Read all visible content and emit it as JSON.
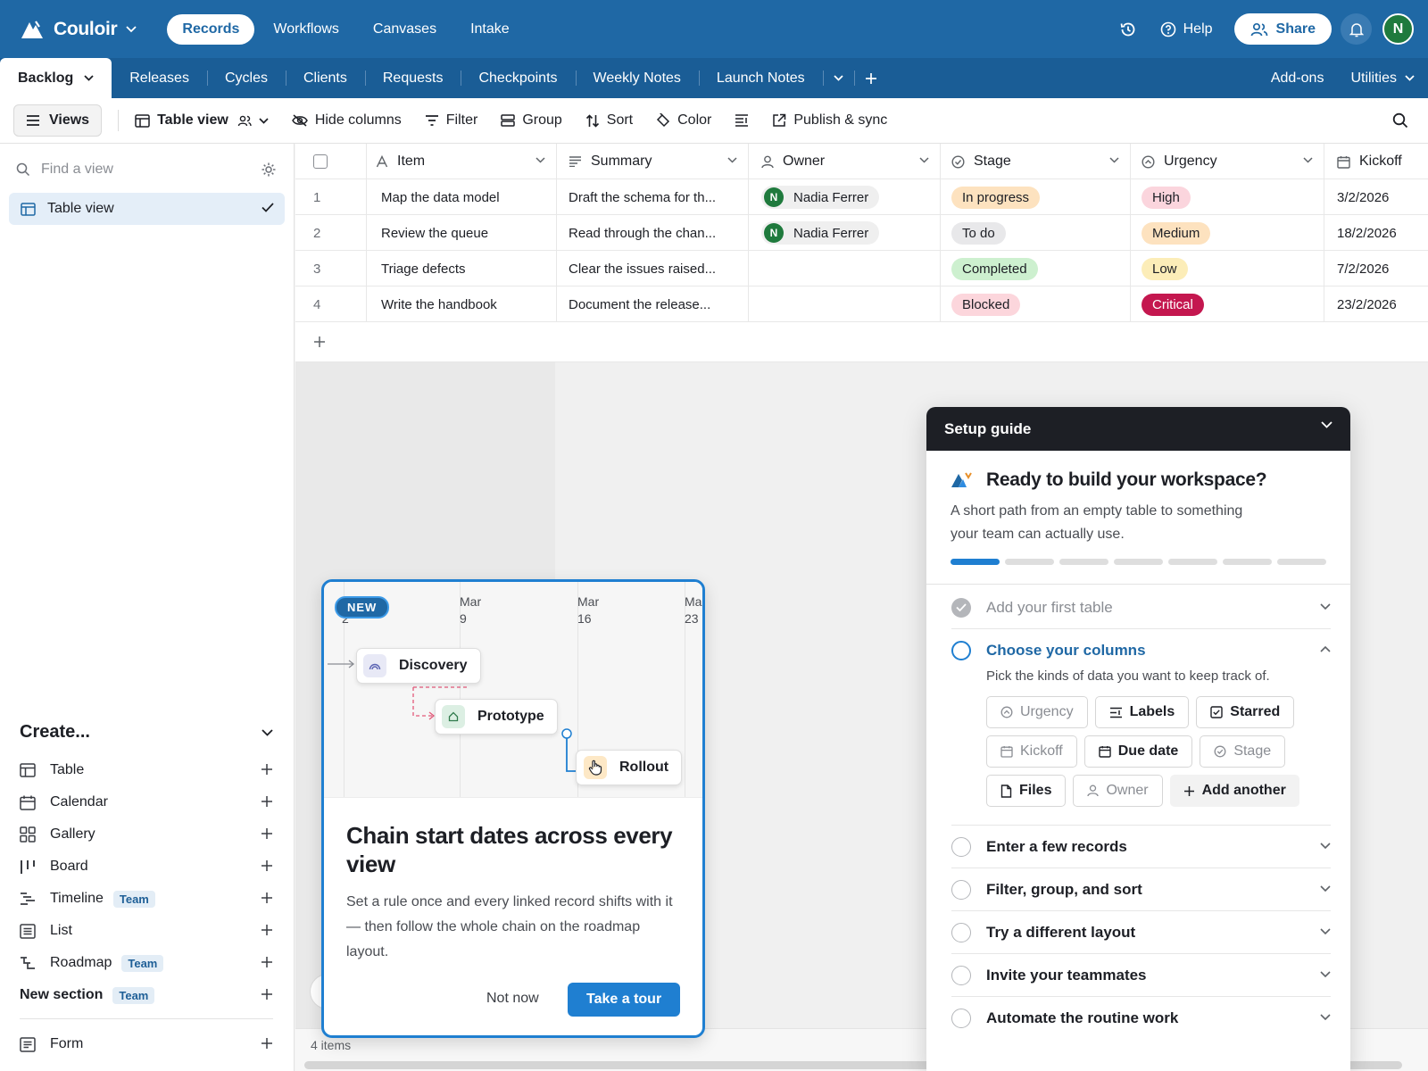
{
  "brand": {
    "name": "Couloir"
  },
  "topnav": {
    "items": [
      "Records",
      "Workflows",
      "Canvases",
      "Intake"
    ]
  },
  "top_right": {
    "help": "Help",
    "share": "Share",
    "user_initial": "N"
  },
  "tables": {
    "tabs": [
      "Backlog",
      "Releases",
      "Cycles",
      "Clients",
      "Requests",
      "Checkpoints",
      "Weekly Notes",
      "Launch Notes"
    ],
    "addons": "Add-ons",
    "utilities": "Utilities"
  },
  "viewbar": {
    "views": "Views",
    "table_view": "Table view",
    "hide_columns": "Hide columns",
    "filter": "Filter",
    "group": "Group",
    "sort": "Sort",
    "color": "Color",
    "publish": "Publish & sync"
  },
  "sidebar": {
    "find_placeholder": "Find a view",
    "active_view": "Table view",
    "create_title": "Create...",
    "create_items": [
      {
        "label": "Table",
        "icon": "table-icon"
      },
      {
        "label": "Calendar",
        "icon": "calendar-icon"
      },
      {
        "label": "Gallery",
        "icon": "gallery-icon"
      },
      {
        "label": "Board",
        "icon": "board-icon"
      },
      {
        "label": "Timeline",
        "icon": "timeline-icon",
        "badge": "Team"
      },
      {
        "label": "List",
        "icon": "list-icon"
      },
      {
        "label": "Roadmap",
        "icon": "roadmap-icon",
        "badge": "Team"
      }
    ],
    "new_section": "New section",
    "new_section_badge": "Team",
    "form": "Form"
  },
  "grid": {
    "columns": [
      "Item",
      "Summary",
      "Owner",
      "Stage",
      "Urgency",
      "Kickoff"
    ],
    "rows": [
      {
        "num": "1",
        "item": "Map the data model",
        "summary": "Draft the schema for th...",
        "owner": "Nadia Ferrer",
        "owner_initial": "N",
        "stage": "In progress",
        "urgency": "High",
        "kickoff": "3/2/2026"
      },
      {
        "num": "2",
        "item": "Review the queue",
        "summary": "Read through the chan...",
        "owner": "Nadia Ferrer",
        "owner_initial": "N",
        "stage": "To do",
        "urgency": "Medium",
        "kickoff": "18/2/2026"
      },
      {
        "num": "3",
        "item": "Triage defects",
        "summary": "Clear the issues raised...",
        "owner": "",
        "owner_initial": "",
        "stage": "Completed",
        "urgency": "Low",
        "kickoff": "7/2/2026"
      },
      {
        "num": "4",
        "item": "Write the handbook",
        "summary": "Document the release...",
        "owner": "",
        "owner_initial": "",
        "stage": "Blocked",
        "urgency": "Critical",
        "kickoff": "23/2/2026"
      }
    ],
    "stage_colors": {
      "In progress": "#fde2bf",
      "To do": "#e8e8ea",
      "Completed": "#cdf0cf",
      "Blocked": "#fcd6dc"
    },
    "urgency_colors": {
      "High": "#fbd5dd",
      "Medium": "#fde2bf",
      "Low": "#fcedb8",
      "Critical": "#c4174f"
    }
  },
  "status": {
    "items": "4 items"
  },
  "feature_card": {
    "badge": "NEW",
    "dates": [
      {
        "month": "M",
        "day": "2"
      },
      {
        "month": "Mar",
        "day": "9"
      },
      {
        "month": "Mar",
        "day": "16"
      },
      {
        "month": "Ma",
        "day": "23"
      }
    ],
    "tasks": [
      "Discovery",
      "Prototype",
      "Rollout"
    ],
    "title": "Chain start dates across every view",
    "body": "Set a rule once and every linked record shifts with it — then follow the whole chain on the roadmap layout.",
    "not_now": "Not now",
    "tour": "Take a tour"
  },
  "setup_guide": {
    "header": "Setup guide",
    "title": "Ready to build your workspace?",
    "subtitle": "A short path from an empty table to something your team can actually use.",
    "progress": {
      "done": 1,
      "total": 7
    },
    "steps": [
      {
        "label": "Add your first table",
        "state": "done"
      },
      {
        "label": "Choose your columns",
        "state": "active",
        "desc": "Pick the kinds of data you want to keep track of.",
        "chips": [
          {
            "label": "Urgency",
            "icon": "urgency-icon",
            "style": "dim"
          },
          {
            "label": "Labels",
            "icon": "labels-icon",
            "style": "strong"
          },
          {
            "label": "Starred",
            "icon": "checkbox-icon",
            "style": "strong"
          },
          {
            "label": "Kickoff",
            "icon": "calendar-icon",
            "style": "dim"
          },
          {
            "label": "Due date",
            "icon": "calendar-icon",
            "style": "strong"
          },
          {
            "label": "Stage",
            "icon": "stage-icon",
            "style": "dim"
          },
          {
            "label": "Files",
            "icon": "file-icon",
            "style": "strong"
          },
          {
            "label": "Owner",
            "icon": "user-icon",
            "style": "dim"
          },
          {
            "label": "Add another",
            "icon": "plus-icon",
            "style": "add"
          }
        ]
      },
      {
        "label": "Enter a few records",
        "state": "todo"
      },
      {
        "label": "Filter, group, and sort",
        "state": "todo"
      },
      {
        "label": "Try a different layout",
        "state": "todo"
      },
      {
        "label": "Invite your teammates",
        "state": "todo"
      },
      {
        "label": "Automate the routine work",
        "state": "todo"
      }
    ]
  }
}
